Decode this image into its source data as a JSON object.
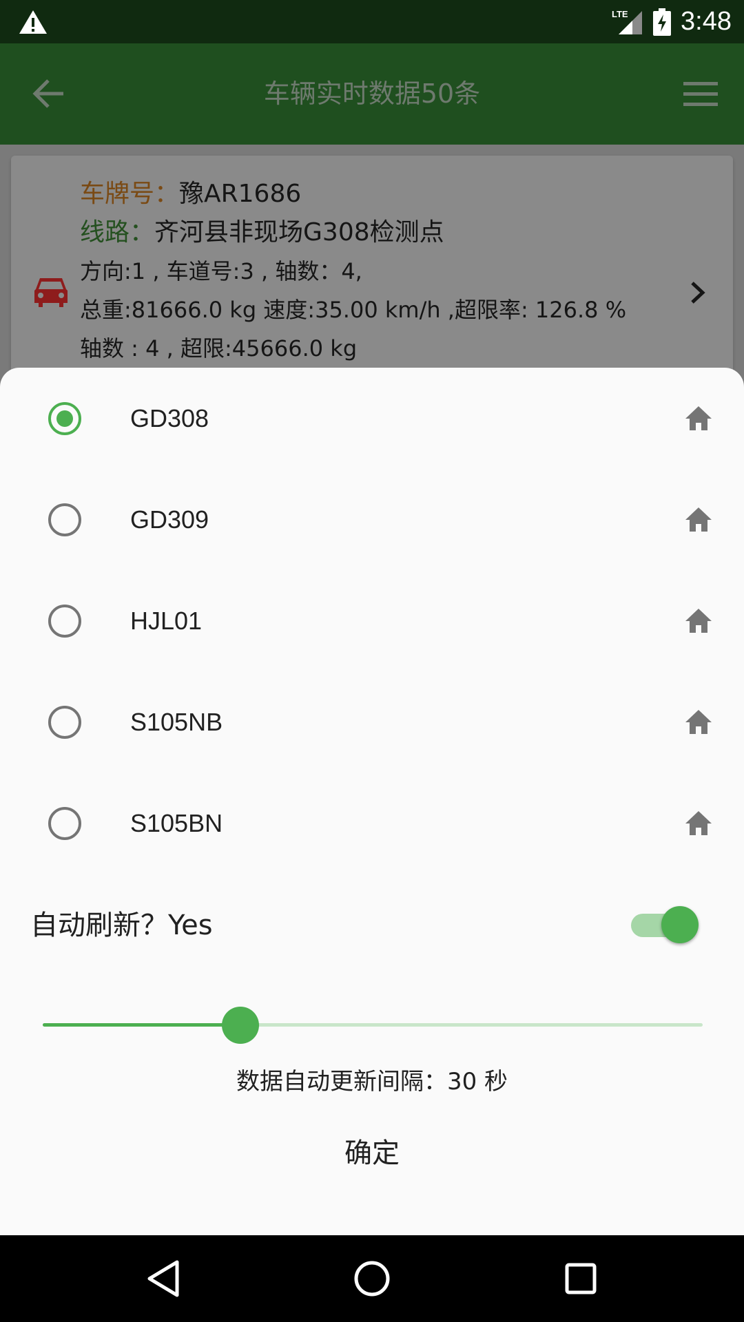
{
  "status_bar": {
    "time": "3:48",
    "network": "LTE"
  },
  "app_bar": {
    "title": "车辆实时数据50条"
  },
  "card": {
    "plate_label": "车牌号：",
    "plate_value": "豫AR1686",
    "route_label": "线路：",
    "route_value": "齐河县非现场G308检测点",
    "line3": "方向:1 , 车道号:3 , 轴数：4,",
    "line4": "总重:81666.0 kg 速度:35.00 km/h  ,超限率: 126.8 %",
    "line5": "轴数 : 4 , 超限:45666.0 kg"
  },
  "dialog": {
    "options": [
      {
        "label": "GD308",
        "selected": true
      },
      {
        "label": "GD309",
        "selected": false
      },
      {
        "label": "HJL01",
        "selected": false
      },
      {
        "label": "S105NB",
        "selected": false
      },
      {
        "label": "S105BN",
        "selected": false
      }
    ],
    "auto_refresh_label": "自动刷新？Yes",
    "auto_refresh_on": true,
    "slider_fraction": 0.3,
    "interval_text": "数据自动更新间隔：30 秒",
    "confirm_label": "确定"
  },
  "colors": {
    "status_bar": "#102a10",
    "app_bar": "#1f4f1f",
    "accent": "#4caf50",
    "sheet": "#fafafa"
  },
  "icons": [
    "warning-icon",
    "lte-signal-icon",
    "battery-charging-icon",
    "back-arrow-icon",
    "menu-icon",
    "car-icon",
    "chevron-right-icon",
    "home-icon",
    "nav-back-icon",
    "nav-home-icon",
    "nav-recents-icon"
  ]
}
